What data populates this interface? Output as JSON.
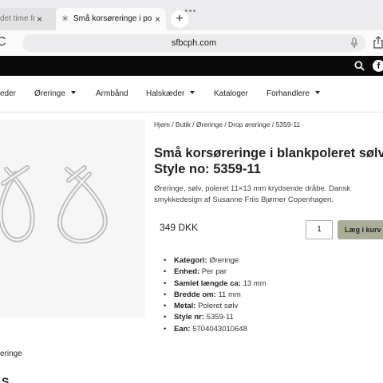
{
  "browser": {
    "tabs": [
      {
        "label": "det time fo",
        "active": false
      },
      {
        "label": "Små korsøreringe i poler",
        "active": true
      }
    ],
    "url": "sfbcph.com",
    "new_tab": "+",
    "close": "×"
  },
  "nav": {
    "items": [
      {
        "label": "eder",
        "dropdown": false
      },
      {
        "label": "Øreringe",
        "dropdown": true
      },
      {
        "label": "Armbånd",
        "dropdown": false
      },
      {
        "label": "Halskæder",
        "dropdown": true
      },
      {
        "label": "Kataloger",
        "dropdown": false
      },
      {
        "label": "Forhandlere",
        "dropdown": true
      }
    ],
    "facebook": "f"
  },
  "product": {
    "breadcrumb": "Hjem / Butik / Øreringe / Drop øreringe / 5359-11",
    "title": "Små korsøreringe i blankpoleret sølv ,",
    "style": "Style no: 5359-11",
    "description": "Øreringe, sølv, poleret 11×13 mm krydsende dråbe. Dansk smykkedesign af Susanne Friis Bjørner Copenhagen.",
    "price": "349 DKK",
    "quantity": "1",
    "add_to_cart": "Læg i kurv",
    "attributes": [
      {
        "key": "Kategori:",
        "value": "Øreringe"
      },
      {
        "key": "Enhed:",
        "value": "Per par"
      },
      {
        "key": "Samlet længde ca:",
        "value": "13 mm"
      },
      {
        "key": "Bredde om:",
        "value": "11 mm"
      },
      {
        "key": "Metal:",
        "value": "Poleret sølv"
      },
      {
        "key": "Style nr:",
        "value": "5359-11"
      },
      {
        "key": "Ean:",
        "value": "5704043010648"
      }
    ]
  },
  "below": {
    "tab_label": "eringe",
    "partial_heading": "S"
  }
}
